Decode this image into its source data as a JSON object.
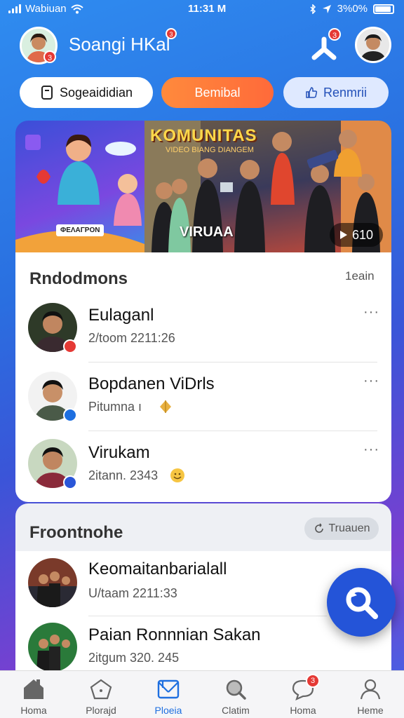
{
  "status_bar": {
    "carrier": "Wabiuan",
    "time": "11:31 M",
    "battery": "3%0%"
  },
  "header": {
    "name": "Soangi HKal",
    "avatar_badge": "3",
    "notif_badge": "3"
  },
  "chips": [
    {
      "label": "Sogeaididian",
      "icon": "bookmark-icon"
    },
    {
      "label": "Bemibal"
    },
    {
      "label": "Renmrii",
      "icon": "thumbs-up-icon"
    }
  ],
  "banner": {
    "title": "KOMUNITAS",
    "subtitle": "VIDEO BIANG DIANGEM",
    "label": "VIRUAA",
    "pill": "610",
    "sticker": "ΦΕΛΑΓΡΟΝ"
  },
  "recommend": {
    "title": "Rndodmons",
    "link": "1eain",
    "items": [
      {
        "name": "Eulaganl",
        "sub": "2/toom 2211:26",
        "more": "···",
        "badge_color": "#e53935"
      },
      {
        "name": "Bopdanen ViDrls",
        "sub": "Pitumna ı",
        "more": "···",
        "badge_color": "#1e6fe0"
      },
      {
        "name": "Virukam",
        "sub": "2itann. 2343",
        "more": "···",
        "badge_color": "#2a56d8"
      }
    ]
  },
  "friends": {
    "title": "Froontnohe",
    "button": "Truauen",
    "items": [
      {
        "name": "Keomaitanbarialall",
        "sub": "U/taam 2211:33"
      },
      {
        "name": "Paian Ronnnian Sakan",
        "sub": "2itgum 320. 245"
      }
    ]
  },
  "nav": [
    {
      "label": "Homa",
      "icon": "home-icon"
    },
    {
      "label": "Plorajd",
      "icon": "pentagon-icon"
    },
    {
      "label": "Ploeia",
      "icon": "envelope-icon",
      "active": true
    },
    {
      "label": "Clatim",
      "icon": "search-icon"
    },
    {
      "label": "Homa",
      "icon": "chat-bubble-icon",
      "badge": "3"
    },
    {
      "label": "Heme",
      "icon": "person-icon"
    }
  ]
}
